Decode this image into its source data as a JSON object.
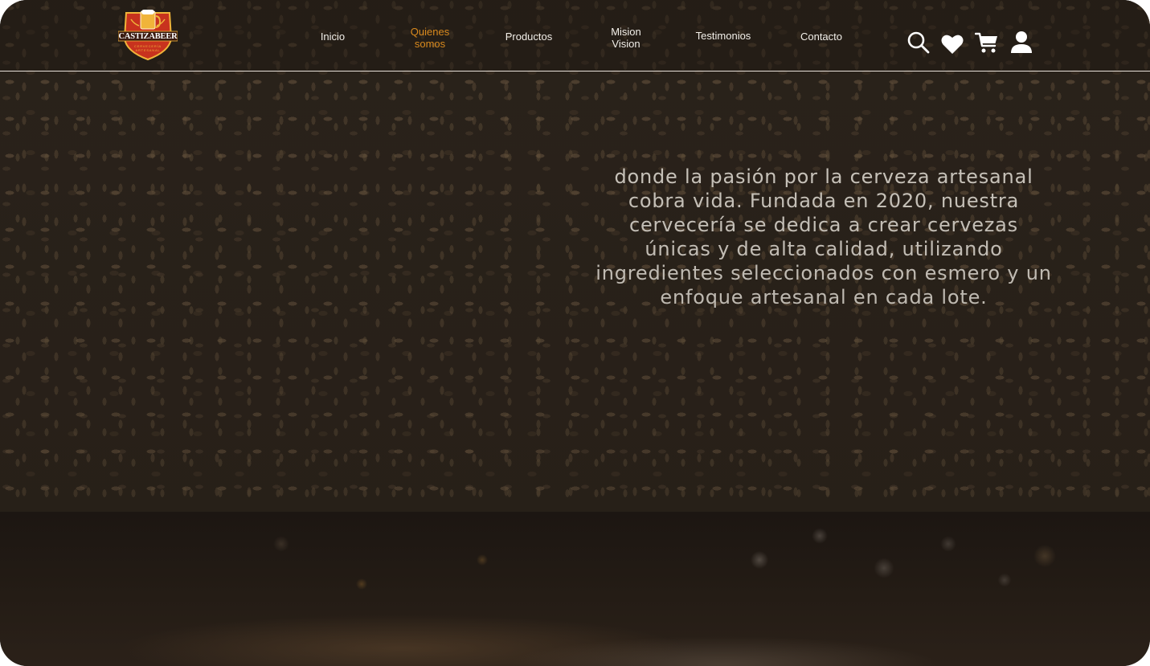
{
  "brand": {
    "name": "CASTIZABEER",
    "tagline": "CERVECERÍA ARTESANAL",
    "colors": {
      "shield_red": "#c8321e",
      "shield_gold": "#f0b43a",
      "ribbon_dark": "#3a1a10"
    }
  },
  "nav": {
    "items": [
      {
        "id": "inicio",
        "line1": "Inicio",
        "line2": "",
        "active": false
      },
      {
        "id": "quienes",
        "line1": "Quienes",
        "line2": "somos",
        "active": true
      },
      {
        "id": "productos",
        "line1": "Productos",
        "line2": "",
        "active": false
      },
      {
        "id": "mision",
        "line1": "Mision",
        "line2": "Vision",
        "active": false
      },
      {
        "id": "testimonios",
        "line1": "Testimonios",
        "line2": "",
        "active": false
      },
      {
        "id": "contacto",
        "line1": "Contacto",
        "line2": "",
        "active": false
      }
    ],
    "active_color": "#d98a1e",
    "text_color": "#f2efe9"
  },
  "header_icons": [
    "search-icon",
    "heart-icon",
    "cart-icon",
    "user-icon"
  ],
  "hero": {
    "text": "donde la pasión por la cerveza artesanal cobra vida. Fundada en 2020, nuestra cervecería se dedica a crear cervezas únicas y de alta calidad, utilizando ingredientes seleccionados con esmero y un enfoque artesanal en cada lote."
  }
}
